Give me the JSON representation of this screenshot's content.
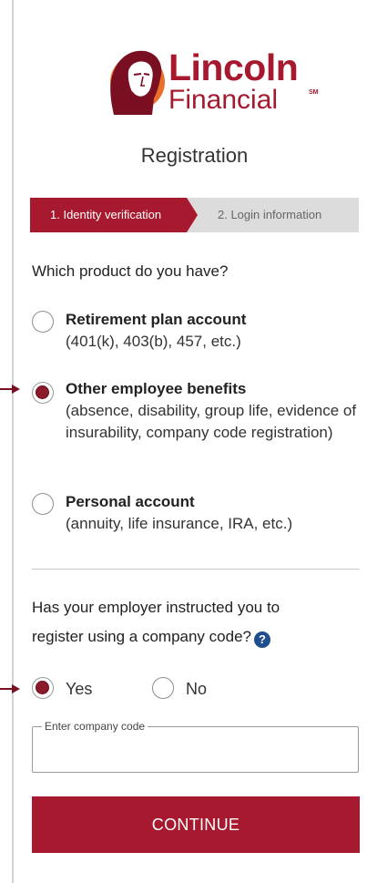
{
  "brand": {
    "name": "Lincoln",
    "sub": "Financial",
    "mark": "SM",
    "color": "#a6192e",
    "icon": "lincoln-portrait-icon"
  },
  "page": {
    "title": "Registration"
  },
  "stepper": {
    "step1": "1. Identity verification",
    "step2": "2. Login information"
  },
  "product_question": "Which product do you have?",
  "product_options": [
    {
      "title": "Retirement plan account",
      "desc": "(401(k), 403(b), 457, etc.)",
      "selected": false
    },
    {
      "title": "Other employee benefits",
      "desc": "(absence, disability, group life, evidence of insurability, company code registration)",
      "selected": true
    },
    {
      "title": "Personal account",
      "desc": "(annuity, life insurance, IRA, etc.)",
      "selected": false
    }
  ],
  "company_code": {
    "question_line1": "Has your employer instructed you to",
    "question_line2": "register using a company code?",
    "help_icon": "question-circle-icon",
    "yes_label": "Yes",
    "no_label": "No",
    "selected": "Yes",
    "field_label": "Enter company code",
    "field_value": ""
  },
  "actions": {
    "continue_label": "CONTINUE"
  },
  "colors": {
    "accent": "#a6192e",
    "selected_dot": "#8b1a2b",
    "help_blue": "#1f4e8f",
    "inactive_step": "#dcdcdc"
  }
}
